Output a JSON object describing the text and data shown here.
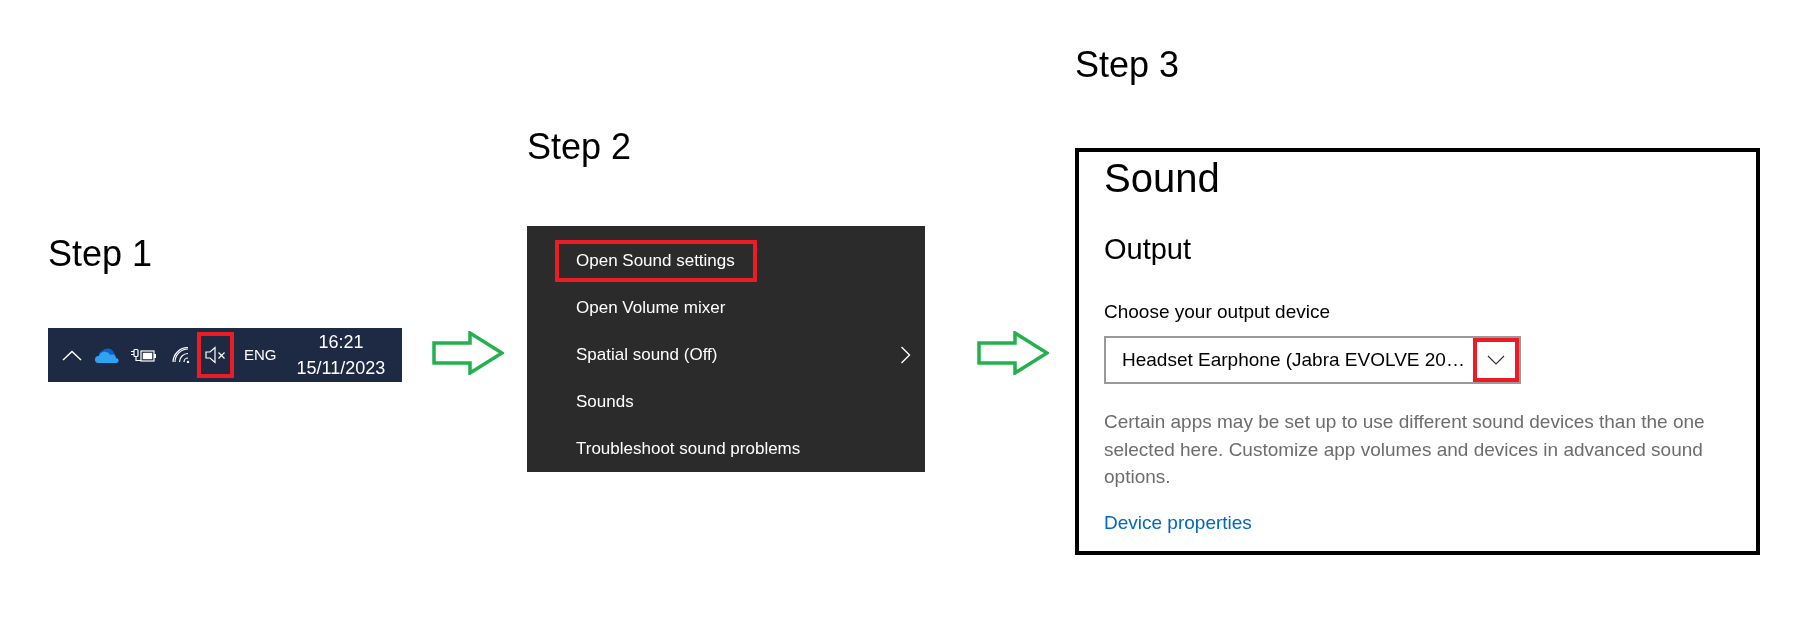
{
  "steps": [
    {
      "kind": "taskbar",
      "label": "Step 1",
      "tray": {
        "volume": {
          "muted": true,
          "highlighted": true
        },
        "language": "ENG",
        "time": "16:21",
        "date": "15/11/2023"
      }
    },
    {
      "kind": "context_menu",
      "label": "Step 2",
      "items": [
        {
          "label": "Open Sound settings",
          "highlighted": true,
          "submenu": false
        },
        {
          "label": "Open Volume mixer",
          "highlighted": false,
          "submenu": false
        },
        {
          "label": "Spatial sound (Off)",
          "highlighted": false,
          "submenu": true
        },
        {
          "label": "Sounds",
          "highlighted": false,
          "submenu": false
        },
        {
          "label": "Troubleshoot sound problems",
          "highlighted": false,
          "submenu": false
        }
      ]
    },
    {
      "kind": "settings_panel",
      "label": "Step 3",
      "title": "Sound",
      "section": "Output",
      "field_label": "Choose your output device",
      "dropdown": {
        "value": "Headset Earphone (Jabra EVOLVE 20…",
        "highlighted": true
      },
      "description": "Certain apps may be set up to use different sound devices than the one selected here. Customize app volumes and devices in advanced sound options.",
      "link": "Device properties"
    }
  ]
}
